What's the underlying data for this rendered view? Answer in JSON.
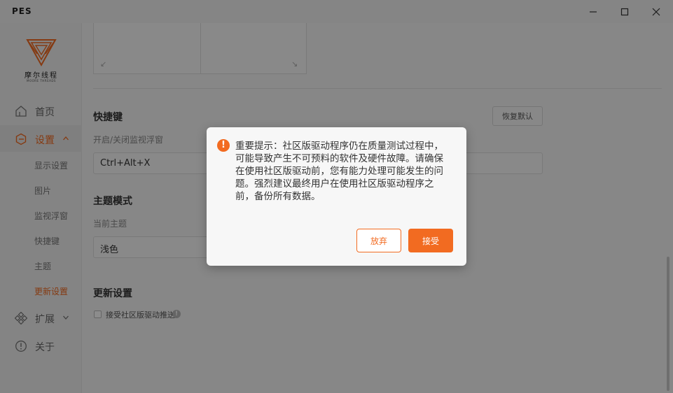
{
  "window": {
    "title": "PES",
    "minimize_icon": "minimize-icon",
    "maximize_icon": "maximize-icon",
    "close_icon": "close-icon"
  },
  "brand": {
    "name": "摩尔线程",
    "sub": "MOORE THREADS",
    "color": "#f26b21"
  },
  "sidebar": {
    "items": [
      {
        "label": "首页",
        "icon": "home-icon"
      },
      {
        "label": "设置",
        "icon": "settings-icon",
        "expanded": true,
        "active": true
      },
      {
        "label": "扩展",
        "icon": "extension-icon",
        "expanded": false
      },
      {
        "label": "关于",
        "icon": "info-icon"
      }
    ],
    "sub_items": [
      {
        "label": "显示设置"
      },
      {
        "label": "图片"
      },
      {
        "label": "监视浮窗"
      },
      {
        "label": "快捷键"
      },
      {
        "label": "主题"
      },
      {
        "label": "更新设置",
        "active": true
      }
    ]
  },
  "content": {
    "shortcut": {
      "title": "快捷键",
      "restore_label": "恢复默认",
      "field_label": "开启/关闭监视浮窗",
      "field_value": "Ctrl+Alt+X"
    },
    "theme": {
      "title": "主题模式",
      "field_label": "当前主题",
      "selected": "浅色"
    },
    "update": {
      "title": "更新设置",
      "checkbox_label": "接受社区版驱动推送",
      "checked": false
    }
  },
  "dialog": {
    "message": "重要提示：社区版驱动程序仍在质量测试过程中，可能导致产生不可预料的软件及硬件故障。请确保在使用社区版驱动前，您有能力处理可能发生的问题。强烈建议最终用户在使用社区版驱动程序之前，备份所有数据。",
    "discard_label": "放弃",
    "accept_label": "接受",
    "icon": "warning-icon"
  },
  "colors": {
    "accent": "#f26b21",
    "overlay": "rgba(0,0,0,0.45)"
  }
}
